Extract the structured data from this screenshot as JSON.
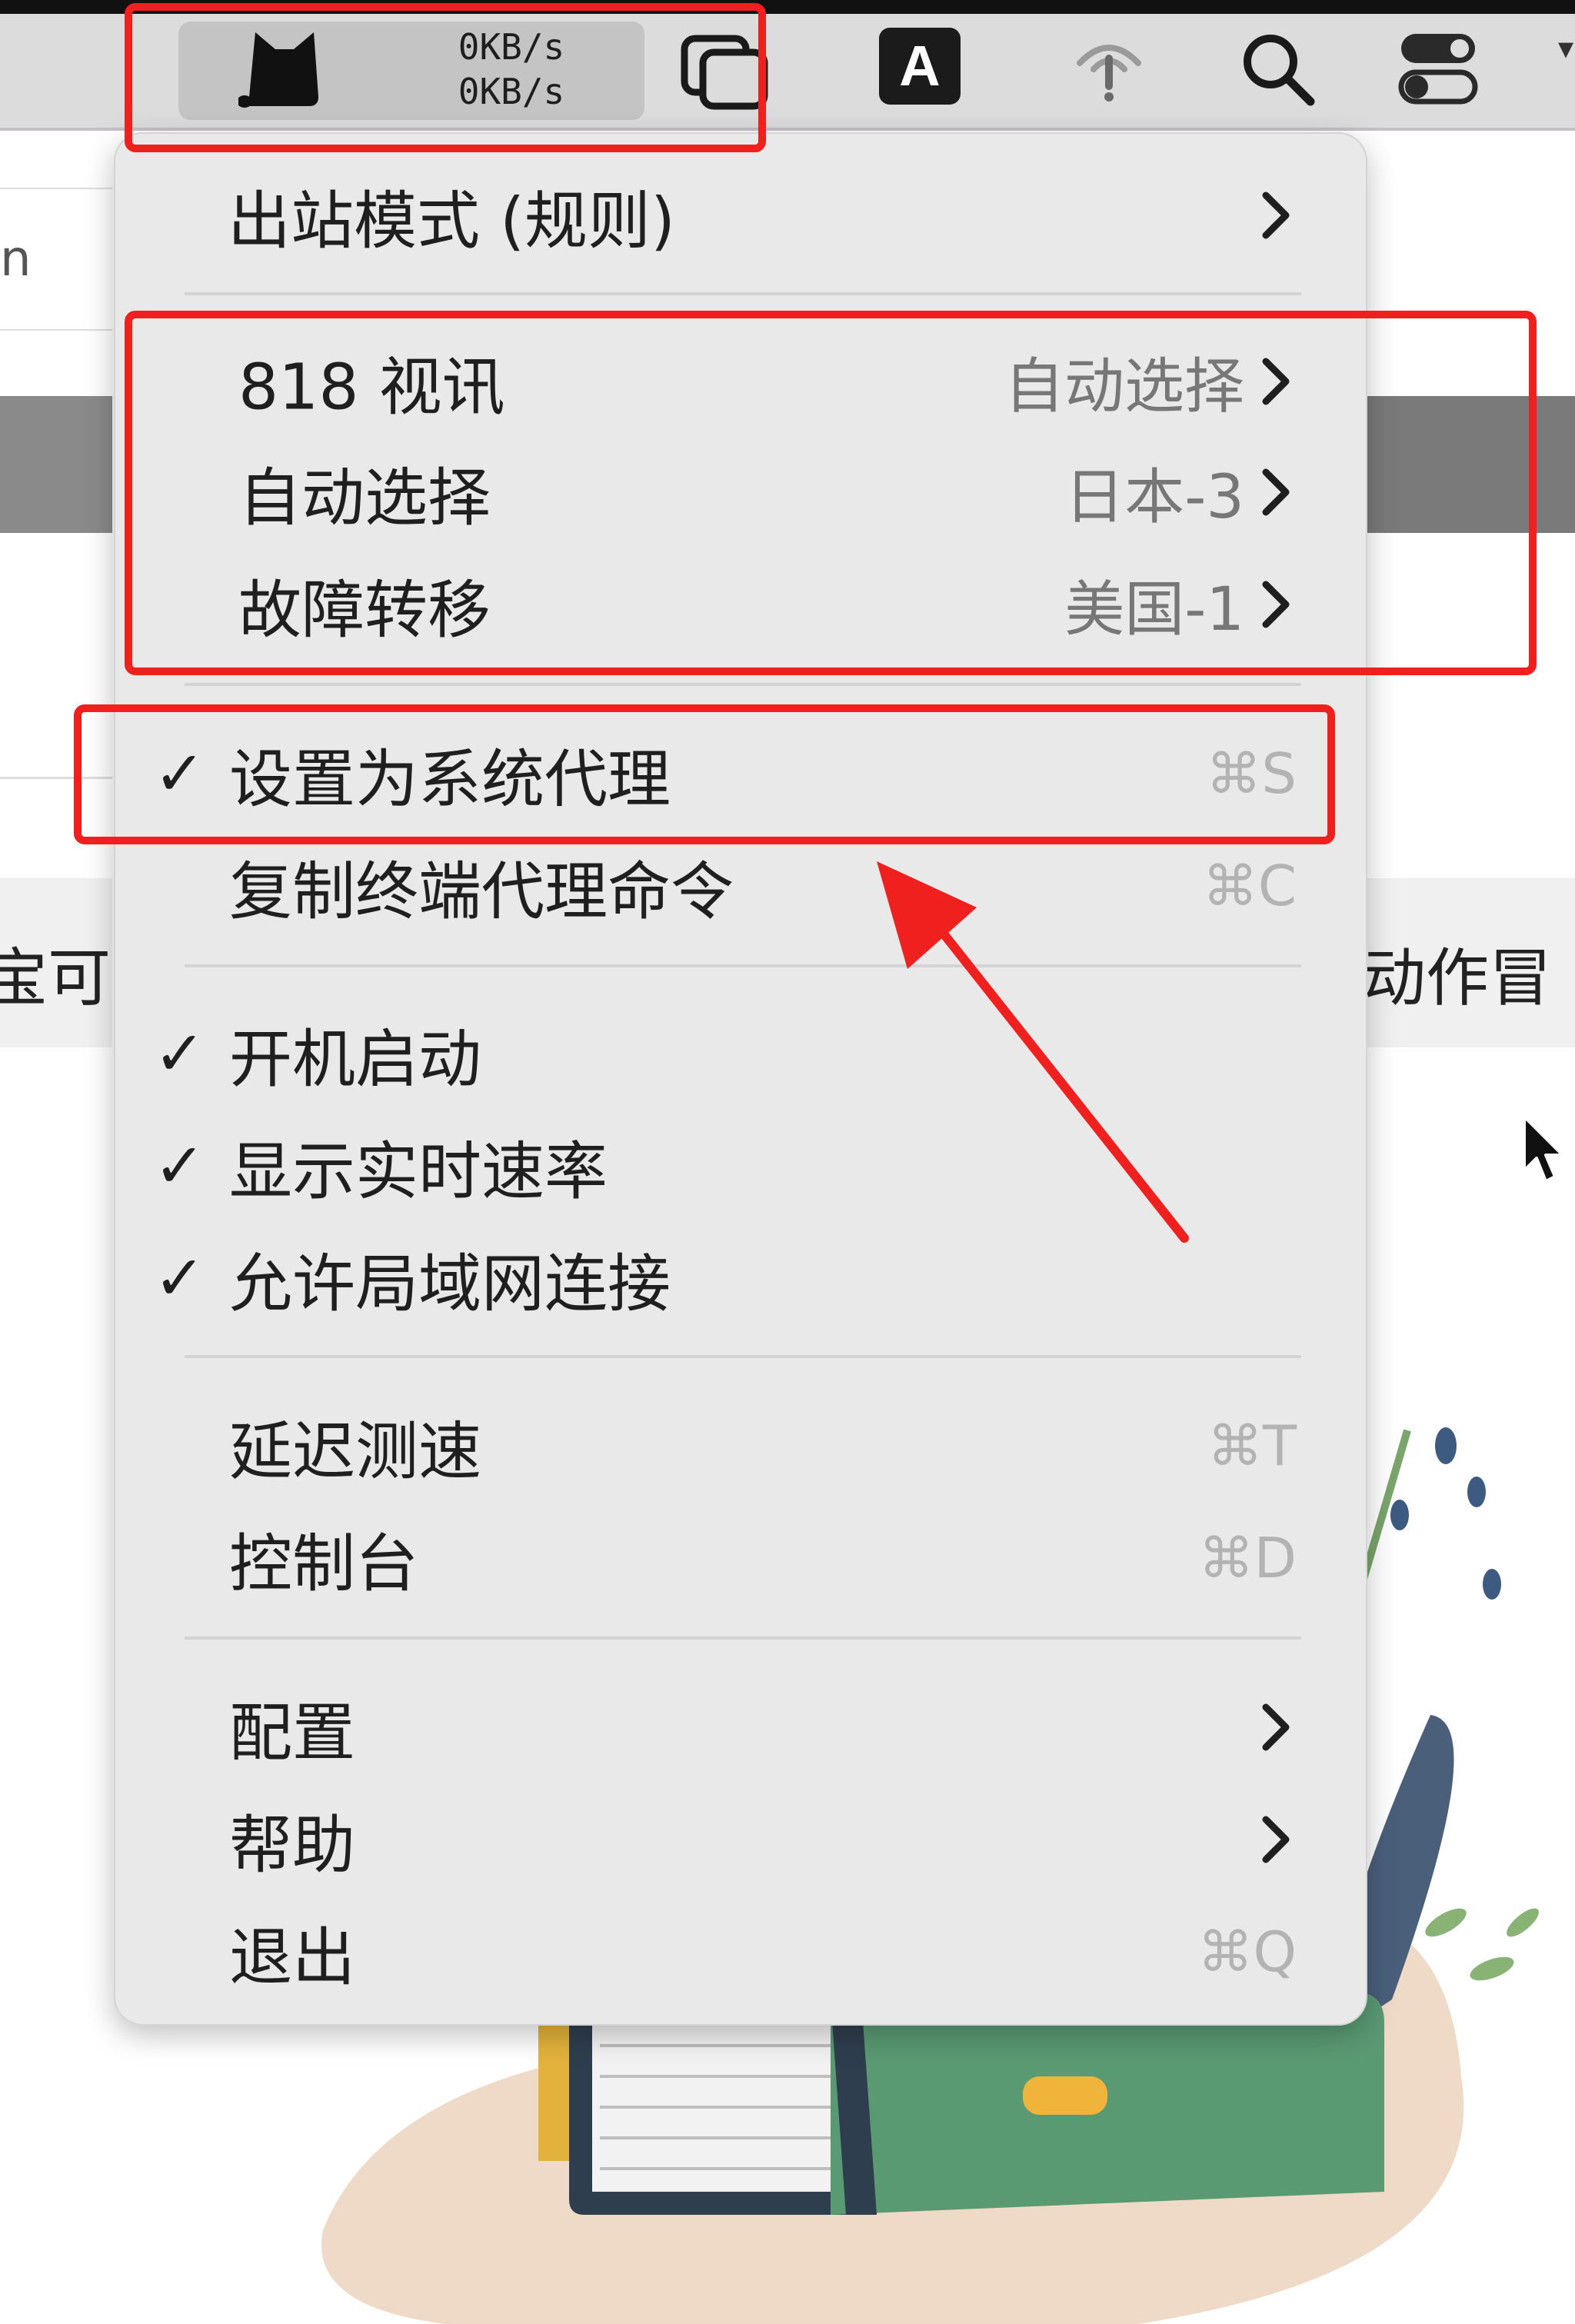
{
  "menubar": {
    "speed_up": "0KB/s",
    "speed_down": "0KB/s",
    "icons": [
      "clash-cat-icon",
      "window-switcher-icon",
      "input-method-icon",
      "antenna-icon",
      "search-icon",
      "control-center-icon"
    ],
    "input_method_letter": "A"
  },
  "background_app": {
    "left_field_fragment": "n",
    "left_text_fragment": "宝可",
    "right_text_fragment": "动作冒"
  },
  "menu": {
    "outbound_mode": "出站模式 (规则)",
    "proxy_groups": [
      {
        "name": "818 视讯",
        "value": "自动选择"
      },
      {
        "name": "自动选择",
        "value": "日本-3"
      },
      {
        "name": "故障转移",
        "value": "美国-1"
      }
    ],
    "set_system_proxy": {
      "label": "设置为系统代理",
      "shortcut": "⌘S",
      "checked": true
    },
    "copy_terminal_cmd": {
      "label": "复制终端代理命令",
      "shortcut": "⌘C"
    },
    "start_at_login": {
      "label": "开机启动",
      "checked": true
    },
    "show_speed": {
      "label": "显示实时速率",
      "checked": true
    },
    "allow_lan": {
      "label": "允许局域网连接",
      "checked": true
    },
    "latency_test": {
      "label": "延迟测速",
      "shortcut": "⌘T"
    },
    "console": {
      "label": "控制台",
      "shortcut": "⌘D"
    },
    "config": {
      "label": "配置"
    },
    "help": {
      "label": "帮助"
    },
    "quit": {
      "label": "退出",
      "shortcut": "⌘Q"
    },
    "check_glyph": "✓"
  },
  "colors": {
    "annotation_red": "#f0201e",
    "menu_bg": "#e9e9e9",
    "menubar_bg": "#dcdcdc"
  }
}
